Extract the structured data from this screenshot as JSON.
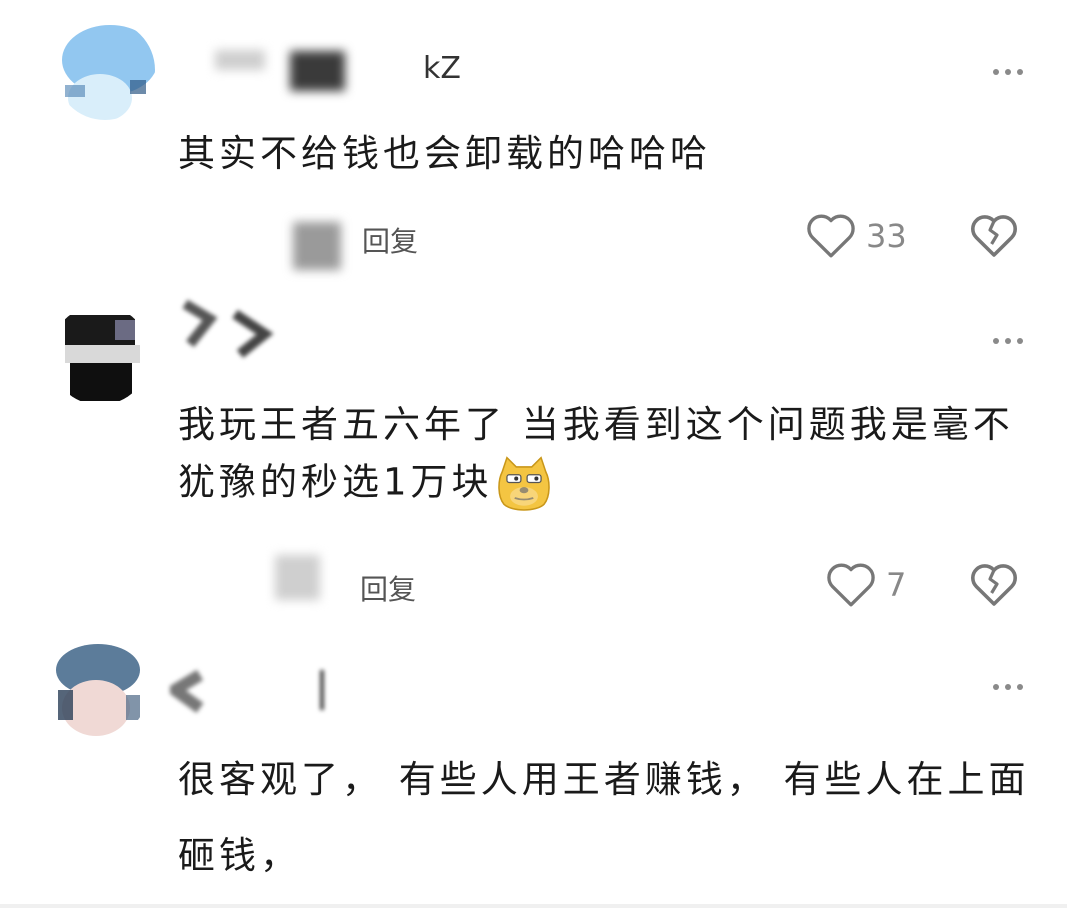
{
  "comments": [
    {
      "username": "kZ",
      "text": "其实不给钱也会卸载的哈哈哈",
      "reply_label": "回复",
      "likes": "33",
      "avatar_colors": [
        "#8cc4ef",
        "#d9eefa"
      ]
    },
    {
      "username": "",
      "text": "我玩王者五六年了 当我看到这个问题我是毫不犹豫的秒选1万块",
      "reply_label": "回复",
      "likes": "7",
      "avatar_colors": [
        "#1a1a1a",
        "#e6e6e6"
      ]
    },
    {
      "username": "",
      "text": "很客观了， 有些人用王者赚钱， 有些人在上面砸钱，",
      "reply_label": "",
      "likes": "",
      "avatar_colors": [
        "#5c7c9a",
        "#f0d9d5"
      ]
    }
  ],
  "icons": {
    "more": "more-dots-icon",
    "like": "heart-icon",
    "dislike": "broken-heart-icon",
    "emoji": "doge-emoji-icon"
  },
  "colors": {
    "text": "#1a1a1a",
    "muted": "#888888",
    "icon": "#777777"
  }
}
